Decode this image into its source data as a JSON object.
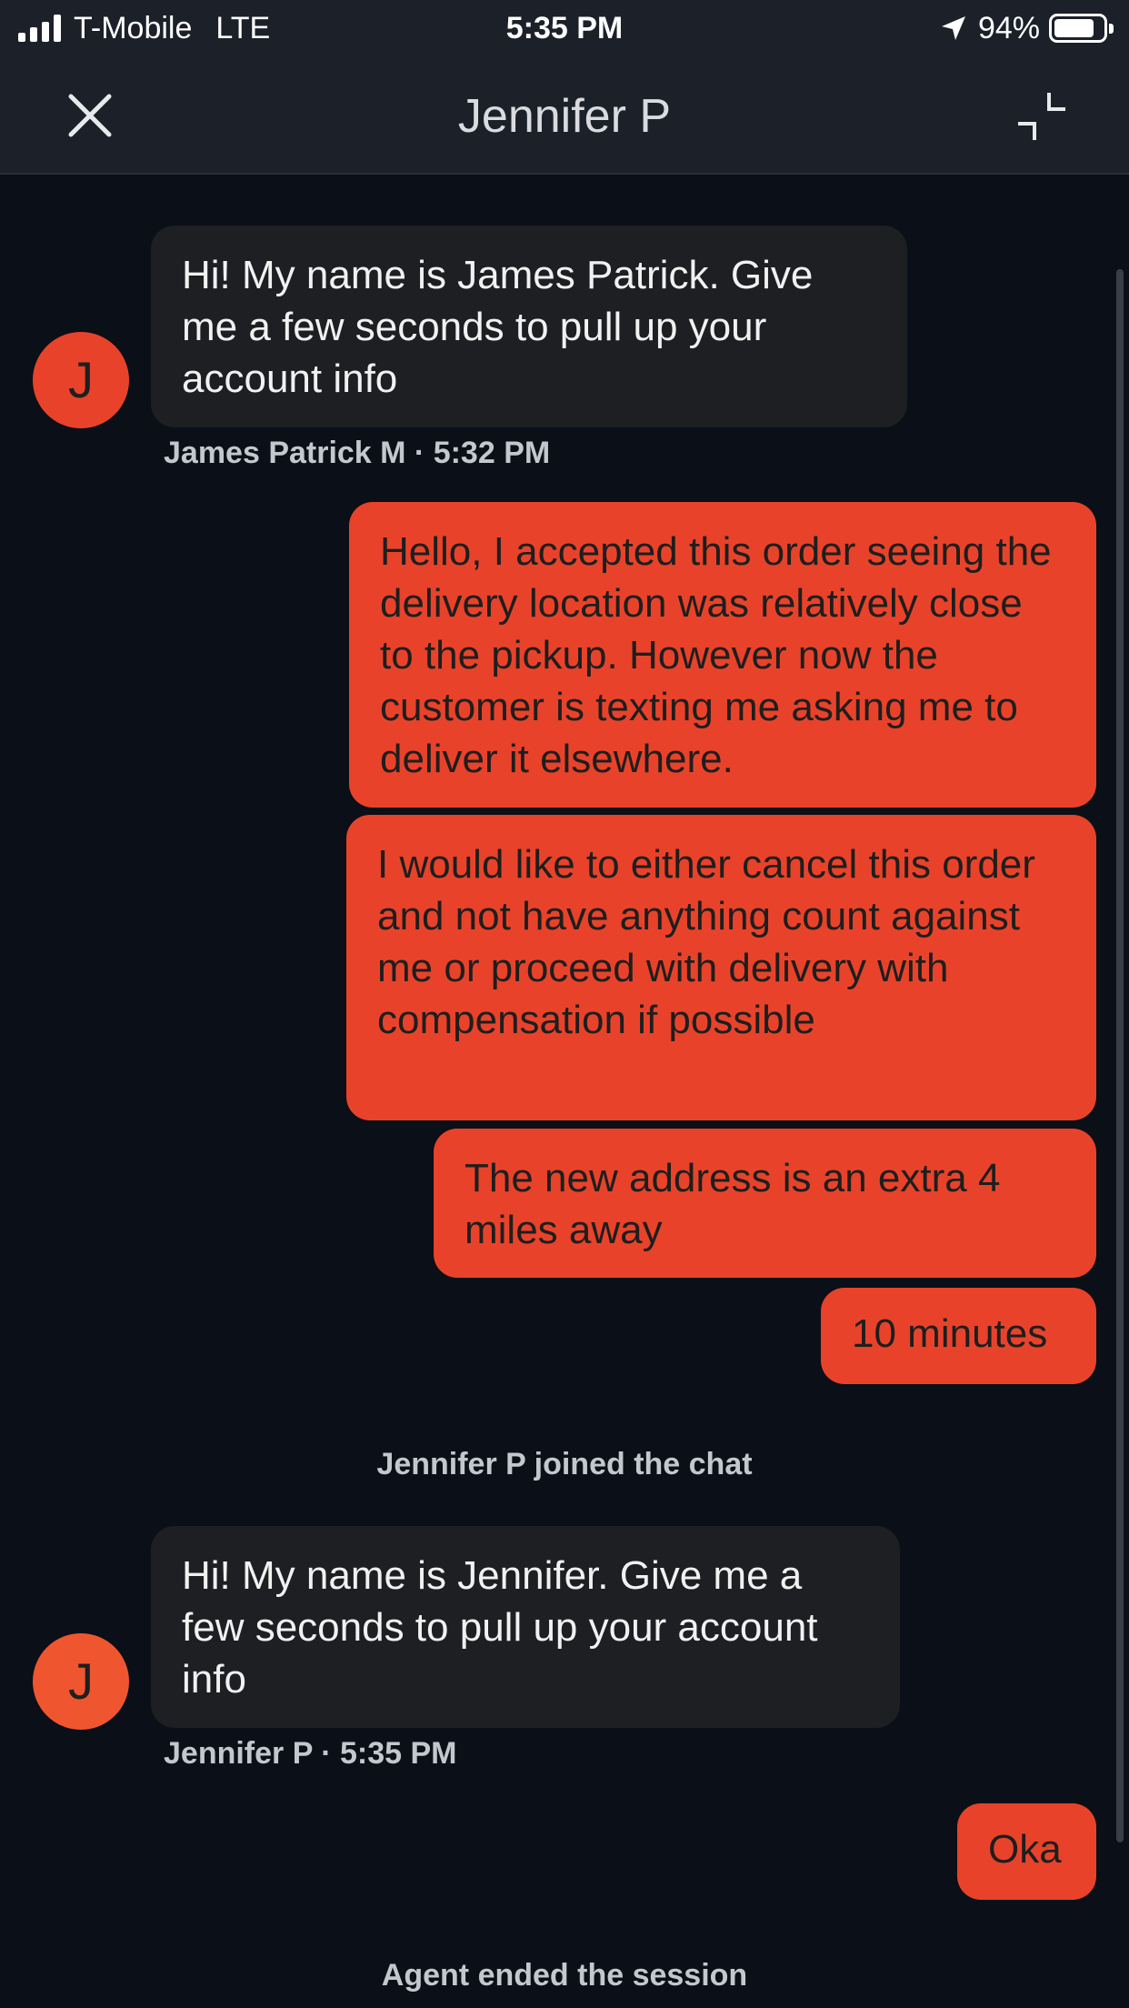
{
  "status_bar": {
    "carrier": "T-Mobile",
    "network": "LTE",
    "time": "5:35 PM",
    "battery_text": "94%",
    "battery_level": 0.94
  },
  "header": {
    "title": "Jennifer P",
    "close_icon": "close-icon",
    "minimize_icon": "minimize-icon"
  },
  "messages": [
    {
      "from": "agent",
      "text": "Hi! My name is James Patrick. Give me a few seconds to pull up your account info",
      "avatar": "J"
    },
    {
      "from": "user",
      "text": "Hello, I accepted this order seeing the delivery location was relatively close to the pickup. However now the customer is texting me asking me to deliver it elsewhere."
    },
    {
      "from": "user",
      "text": "I would like to either cancel this order and not have anything count against me or proceed with delivery with compensation if possible"
    },
    {
      "from": "user",
      "text": "The new address is an extra 4 miles away"
    },
    {
      "from": "user",
      "text": "10 minutes"
    },
    {
      "from": "agent",
      "text": "Hi! My name is Jennifer. Give me a few seconds to pull up your account info",
      "avatar": "J"
    },
    {
      "from": "user",
      "text": "Oka"
    }
  ],
  "meta": {
    "agent1": "James Patrick M · 5:32 PM",
    "agent2": "Jennifer P · 5:35 PM"
  },
  "system": {
    "joined": "Jennifer P joined the chat",
    "ended": "Agent ended the session"
  },
  "colors": {
    "background": "#0b0f17",
    "header": "#1b2029",
    "user_bubble": "#e8432a",
    "agent_bubble": "#1d1f22",
    "meta_text": "#c4c7cd"
  }
}
